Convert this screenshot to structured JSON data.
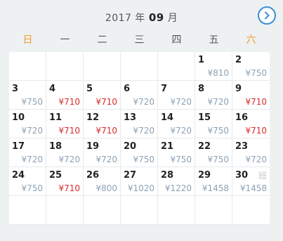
{
  "header": {
    "year": "2017",
    "year_unit": "年",
    "month": "09",
    "month_unit": "月",
    "next_icon": "chevron-right-icon",
    "accent": "#3a8fd9"
  },
  "weekdays": [
    "日",
    "一",
    "二",
    "三",
    "四",
    "五",
    "六"
  ],
  "colors": {
    "weekend": "#f29a2e",
    "low_price": "#d62b2b",
    "price": "#8da2b5"
  },
  "leading_blanks": 5,
  "days": [
    {
      "day": "1",
      "price": "¥810",
      "low": false
    },
    {
      "day": "2",
      "price": "¥750",
      "low": false
    },
    {
      "day": "3",
      "price": "¥750",
      "low": false
    },
    {
      "day": "4",
      "price": "¥710",
      "low": true
    },
    {
      "day": "5",
      "price": "¥710",
      "low": true
    },
    {
      "day": "6",
      "price": "¥720",
      "low": false
    },
    {
      "day": "7",
      "price": "¥720",
      "low": false
    },
    {
      "day": "8",
      "price": "¥720",
      "low": false
    },
    {
      "day": "9",
      "price": "¥710",
      "low": true
    },
    {
      "day": "10",
      "price": "¥720",
      "low": false
    },
    {
      "day": "11",
      "price": "¥710",
      "low": true
    },
    {
      "day": "12",
      "price": "¥710",
      "low": true
    },
    {
      "day": "13",
      "price": "¥720",
      "low": false
    },
    {
      "day": "14",
      "price": "¥720",
      "low": false
    },
    {
      "day": "15",
      "price": "¥750",
      "low": false
    },
    {
      "day": "16",
      "price": "¥710",
      "low": true
    },
    {
      "day": "17",
      "price": "¥720",
      "low": false
    },
    {
      "day": "18",
      "price": "¥720",
      "low": false
    },
    {
      "day": "19",
      "price": "¥720",
      "low": false
    },
    {
      "day": "20",
      "price": "¥750",
      "low": false
    },
    {
      "day": "21",
      "price": "¥750",
      "low": false
    },
    {
      "day": "22",
      "price": "¥750",
      "low": false
    },
    {
      "day": "23",
      "price": "¥720",
      "low": false
    },
    {
      "day": "24",
      "price": "¥750",
      "low": false
    },
    {
      "day": "25",
      "price": "¥710",
      "low": true
    },
    {
      "day": "26",
      "price": "¥800",
      "low": false
    },
    {
      "day": "27",
      "price": "¥1020",
      "low": false
    },
    {
      "day": "28",
      "price": "¥1220",
      "low": false
    },
    {
      "day": "29",
      "price": "¥1458",
      "low": false
    },
    {
      "day": "30",
      "price": "¥1458",
      "low": false,
      "tag": "班"
    }
  ],
  "total_cells": 42
}
